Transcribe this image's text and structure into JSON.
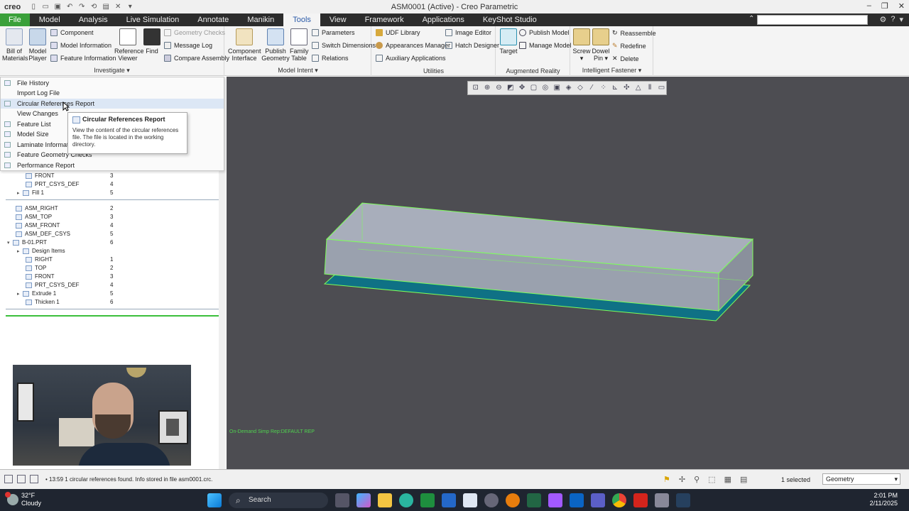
{
  "app": {
    "logo": "creo",
    "window_title": "ASM0001 (Active) - Creo Parametric"
  },
  "tabs": [
    {
      "label": "File"
    },
    {
      "label": "Model"
    },
    {
      "label": "Analysis"
    },
    {
      "label": "Live Simulation"
    },
    {
      "label": "Annotate"
    },
    {
      "label": "Manikin"
    },
    {
      "label": "Tools"
    },
    {
      "label": "View"
    },
    {
      "label": "Framework"
    },
    {
      "label": "Applications"
    },
    {
      "label": "KeyShot Studio"
    }
  ],
  "ribbon": {
    "investigate": {
      "title": "Investigate",
      "bill_of_materials": "Bill of Materials",
      "model_player": "Model Player",
      "component": "Component",
      "model_information": "Model Information",
      "feature_information": "Feature Information",
      "reference_viewer": "Reference Viewer",
      "find": "Find",
      "geometry_checks": "Geometry Checks",
      "message_log": "Message Log",
      "compare_assembly": "Compare Assembly"
    },
    "model_intent": {
      "title": "Model Intent",
      "component_interface": "Component Interface",
      "publish_geometry": "Publish Geometry",
      "family_table": "Family Table",
      "parameters": "Parameters",
      "switch_dimensions": "Switch Dimensions",
      "relations": "Relations"
    },
    "utilities": {
      "title": "Utilities",
      "udf_library": "UDF Library",
      "appearances_manager": "Appearances Manager",
      "auxiliary_applications": "Auxiliary Applications",
      "image_editor": "Image Editor",
      "hatch_designer": "Hatch Designer"
    },
    "augmented_reality": {
      "title": "Augmented Reality",
      "target": "Target",
      "publish_model": "Publish Model",
      "manage_model": "Manage Model"
    },
    "intelligent_fastener": {
      "title": "Intelligent Fastener",
      "screw": "Screw",
      "dowel_pin": "Dowel Pin",
      "reassemble": "Reassemble",
      "redefine": "Redefine",
      "delete": "Delete"
    }
  },
  "menu": {
    "items": [
      {
        "label": "File History"
      },
      {
        "label": "Import Log File"
      },
      {
        "label": "Circular References Report"
      },
      {
        "label": "View Changes"
      },
      {
        "label": "Feature List"
      },
      {
        "label": "Model Size"
      },
      {
        "label": "Laminate Informatio"
      },
      {
        "label": "Feature Geometry Checks"
      },
      {
        "label": "Performance Report"
      }
    ]
  },
  "tooltip": {
    "title": "Circular References Report",
    "body": "View the content of the circular references file. The file is located in the working directory."
  },
  "tree": {
    "rows": [
      {
        "label": "FRONT",
        "num": "3"
      },
      {
        "label": "PRT_CSYS_DEF",
        "num": "4"
      },
      {
        "label": "Fill 1",
        "num": "5"
      },
      {
        "label": "ASM_RIGHT",
        "num": "2"
      },
      {
        "label": "ASM_TOP",
        "num": "3"
      },
      {
        "label": "ASM_FRONT",
        "num": "4"
      },
      {
        "label": "ASM_DEF_CSYS",
        "num": "5"
      },
      {
        "label": "B-01.PRT",
        "num": "6"
      },
      {
        "label": "Design Items",
        "num": ""
      },
      {
        "label": "RIGHT",
        "num": "1"
      },
      {
        "label": "TOP",
        "num": "2"
      },
      {
        "label": "FRONT",
        "num": "3"
      },
      {
        "label": "PRT_CSYS_DEF",
        "num": "4"
      },
      {
        "label": "Extrude 1",
        "num": "5"
      },
      {
        "label": "Thicken 1",
        "num": "6"
      }
    ]
  },
  "graphics": {
    "simp_rep": "On-Demand Simp Rep:DEFAULT REP"
  },
  "statusbar": {
    "message": "13:59 1 circular references found. Info stored in file asm0001.crc.",
    "selected": "1 selected",
    "filter": "Geometry"
  },
  "taskbar": {
    "temp": "32°F",
    "condition": "Cloudy",
    "search": "Search",
    "time": "2:01 PM",
    "date": "2/11/2025"
  },
  "colors": {
    "file_tab": "#3aa03a",
    "highlight": "#dce7f5",
    "model_edge": "#7dff5a",
    "model_face": "#a6acb8",
    "model_bottom": "#0f7185"
  }
}
